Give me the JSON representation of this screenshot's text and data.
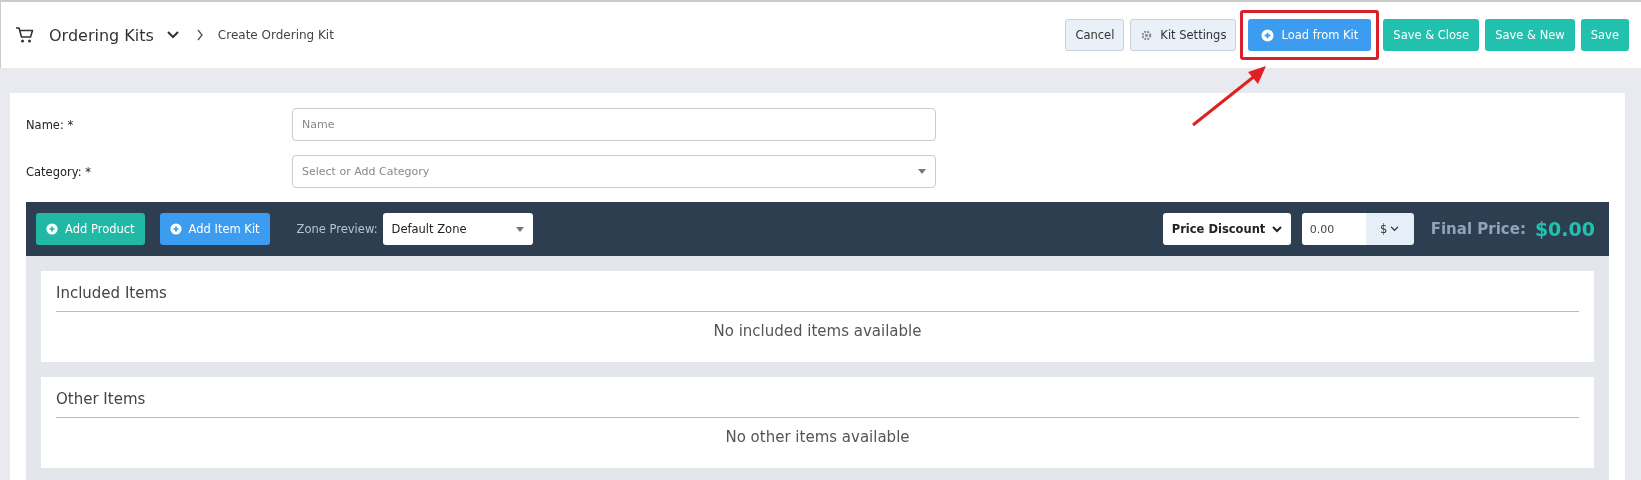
{
  "header": {
    "title": "Ordering Kits",
    "breadcrumb": "Create Ordering Kit"
  },
  "actions": [
    {
      "label": "Cancel",
      "kind": "plain",
      "highlighted": false
    },
    {
      "label": "Kit Settings",
      "kind": "settings",
      "highlighted": false
    },
    {
      "label": "Load from Kit",
      "kind": "load",
      "highlighted": true
    },
    {
      "label": "Save & Close",
      "kind": "save",
      "highlighted": false
    },
    {
      "label": "Save & New",
      "kind": "save",
      "highlighted": false
    },
    {
      "label": "Save",
      "kind": "save",
      "highlighted": false
    }
  ],
  "form": [
    {
      "label": "Name: *",
      "kind": "text",
      "placeholder": "Name"
    },
    {
      "label": "Category: *",
      "kind": "select",
      "placeholder": "Select or Add Category"
    }
  ],
  "toolbar": {
    "buttons": [
      {
        "label": "Add Product",
        "kind": "product"
      },
      {
        "label": "Add Item Kit",
        "kind": "kit"
      }
    ],
    "zone_label": "Zone Preview:",
    "zone_value": "Default Zone",
    "discount_type": "Price Discount",
    "discount_value": "0.00",
    "discount_unit": "$",
    "final_price_label": "Final Price:",
    "final_price": "$0.00"
  },
  "sections": [
    {
      "title": "Included Items",
      "empty": "No included items available"
    },
    {
      "title": "Other Items",
      "empty": "No other items available"
    }
  ]
}
